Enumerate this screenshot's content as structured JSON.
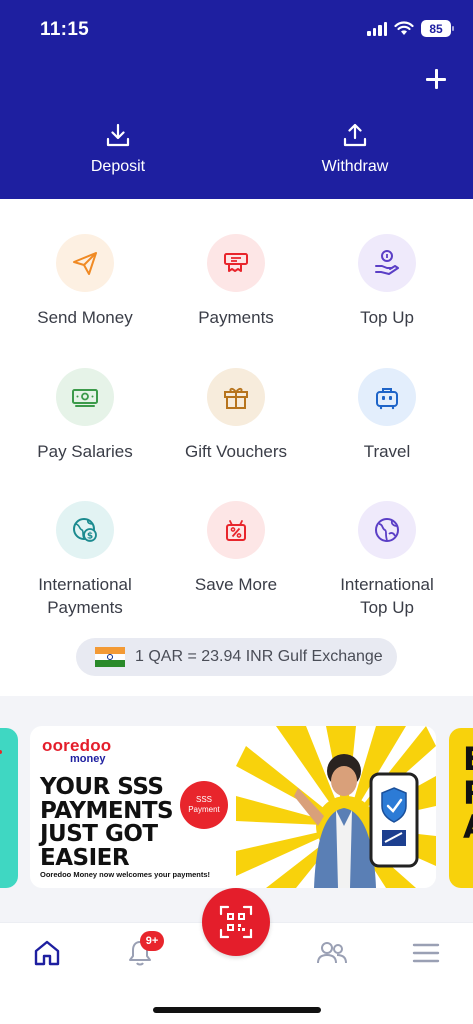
{
  "status_bar": {
    "time": "11:15",
    "battery": "85"
  },
  "header": {
    "add_icon": "plus-icon",
    "actions": [
      {
        "label": "Deposit",
        "icon": "download-tray-icon"
      },
      {
        "label": "Withdraw",
        "icon": "upload-tray-icon"
      }
    ]
  },
  "services": [
    {
      "label": "Send Money",
      "icon": "paper-plane-icon",
      "icon_color": "#f08a24",
      "bg": "#fdf0e2"
    },
    {
      "label": "Payments",
      "icon": "bill-payment-icon",
      "icon_color": "#e8252c",
      "bg": "#fde6e6"
    },
    {
      "label": "Top Up",
      "icon": "hand-coin-icon",
      "icon_color": "#5b3fc6",
      "bg": "#efeafb"
    },
    {
      "label": "Pay Salaries",
      "icon": "cash-icon",
      "icon_color": "#3c9a4a",
      "bg": "#e6f3e8"
    },
    {
      "label": "Gift Vouchers",
      "icon": "gift-box-icon",
      "icon_color": "#b7741d",
      "bg": "#f7ecdc"
    },
    {
      "label": "Travel",
      "icon": "suitcase-icon",
      "icon_color": "#1e64c8",
      "bg": "#e3eefc"
    },
    {
      "label": "International\nPayments",
      "label_lines": [
        "International",
        "Payments"
      ],
      "icon": "globe-dollar-icon",
      "icon_color": "#1b8a8f",
      "bg": "#e2f3f3"
    },
    {
      "label": "Save More",
      "icon": "discount-gift-icon",
      "icon_color": "#e8252c",
      "bg": "#fde6e6"
    },
    {
      "label": "International\nTop Up",
      "label_lines": [
        "International",
        "Top Up"
      ],
      "icon": "globe-icon",
      "icon_color": "#5b3fc6",
      "bg": "#efeafb"
    }
  ],
  "exchange": {
    "text": "1 QAR = 23.94 INR Gulf Exchange",
    "flag": "india-flag-icon"
  },
  "banner": {
    "brand": "ooredoo",
    "brand_sub": "money",
    "headline": [
      "YOUR SSS",
      "PAYMENTS",
      "JUST GOT",
      "EASIER"
    ],
    "badge_lines": [
      "SSS",
      "Payment"
    ],
    "tagline": "Ooredoo Money now welcomes your payments!",
    "next_peek_letters": [
      "E",
      "R",
      "A"
    ]
  },
  "bottom_nav": {
    "notifications_badge": "9+",
    "items": [
      "home-icon",
      "bell-icon",
      "qr-scan-icon",
      "users-icon",
      "menu-icon"
    ]
  },
  "colors": {
    "header": "#1e1fa0",
    "accent_red": "#e41e2b",
    "banner_yellow": "#f8d20c"
  }
}
